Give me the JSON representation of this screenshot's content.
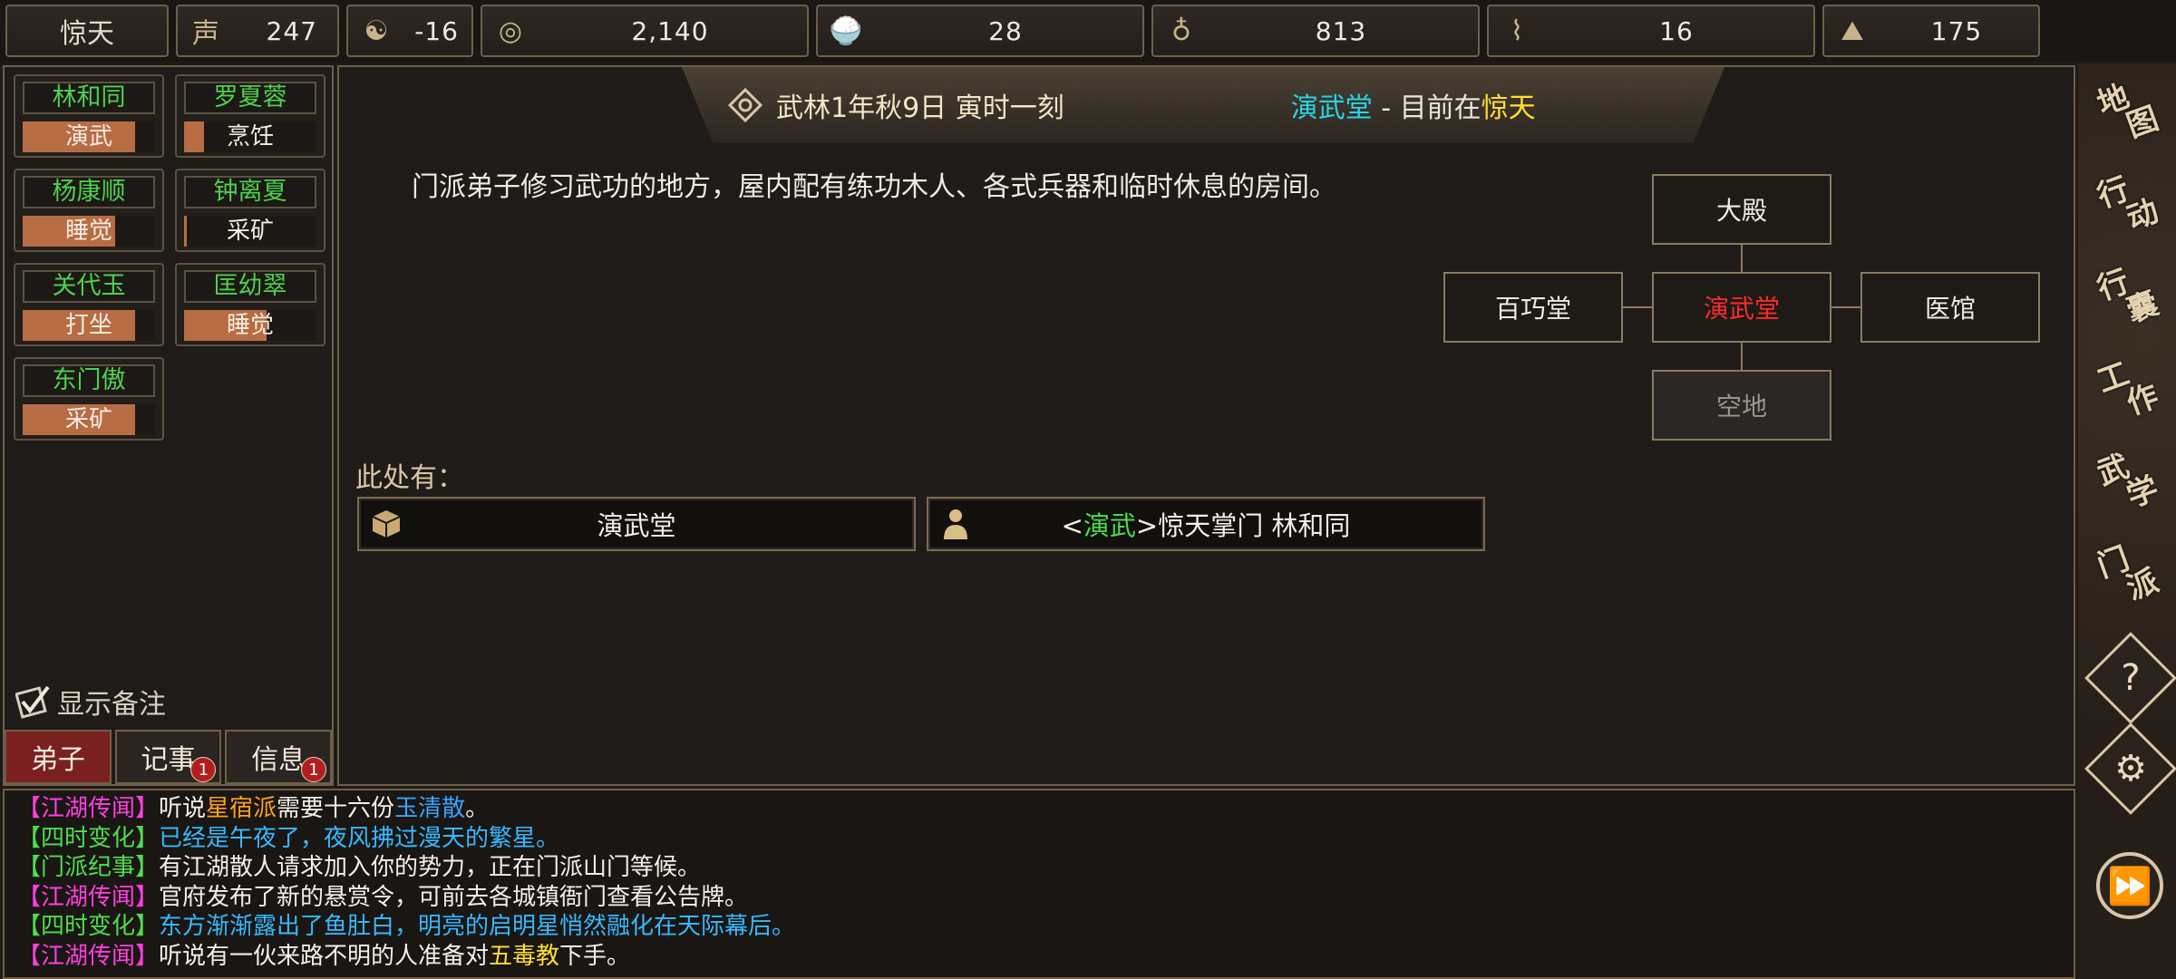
{
  "topbar": {
    "sect_name": "惊天",
    "resources": [
      {
        "icon": "reputation-icon",
        "glyph": "声",
        "value": "247"
      },
      {
        "icon": "yin-yang-icon",
        "glyph": "☯",
        "value": "-16"
      },
      {
        "icon": "coin-icon",
        "glyph": "◎",
        "value": "2,140"
      },
      {
        "icon": "food-bowl-icon",
        "glyph": "🍚",
        "value": "28"
      },
      {
        "icon": "gourd-icon",
        "glyph": "♁",
        "value": "813"
      },
      {
        "icon": "wood-log-icon",
        "glyph": "⌇",
        "value": "16"
      },
      {
        "icon": "ore-icon",
        "glyph": "⛰",
        "value": "175"
      }
    ]
  },
  "disciples": [
    {
      "name": "林和同",
      "activity": "演武",
      "progress": 0.85
    },
    {
      "name": "罗夏蓉",
      "activity": "烹饪",
      "progress": 0.15
    },
    {
      "name": "杨康顺",
      "activity": "睡觉",
      "progress": 0.7
    },
    {
      "name": "钟离夏",
      "activity": "采矿",
      "progress": 0.02
    },
    {
      "name": "关代玉",
      "activity": "打坐",
      "progress": 0.85
    },
    {
      "name": "匡幼翠",
      "activity": "睡觉",
      "progress": 0.62
    },
    {
      "name": "东门傲",
      "activity": "采矿",
      "progress": 0.85
    }
  ],
  "left_panel": {
    "notes_toggle_label": "显示备注",
    "tabs": [
      {
        "label": "弟子",
        "badge": ""
      },
      {
        "label": "记事",
        "badge": "1"
      },
      {
        "label": "信息",
        "badge": "1"
      }
    ]
  },
  "header": {
    "date": "武林1年秋9日 寅时一刻",
    "location_name": "演武堂",
    "location_sep": " - 目前在",
    "location_sect": "惊天"
  },
  "description": "门派弟子修习武功的地方，屋内配有练功木人、各式兵器和临时休息的房间。",
  "map": {
    "north": "大殿",
    "west": "百巧堂",
    "center": "演武堂",
    "east": "医馆",
    "south": "空地"
  },
  "here": {
    "label": "此处有：",
    "items": [
      {
        "icon": "box-icon",
        "text": "演武堂"
      },
      {
        "icon": "person-icon",
        "prefix": "<",
        "role": "演武",
        "suffix": ">惊天掌门  林和同"
      }
    ]
  },
  "right_menu": [
    {
      "label": [
        "地",
        "图"
      ]
    },
    {
      "label": [
        "行",
        "动"
      ]
    },
    {
      "label": [
        "行",
        "囊"
      ]
    },
    {
      "label": [
        "工",
        "作"
      ]
    },
    {
      "label": [
        "武",
        "学"
      ]
    },
    {
      "label": [
        "门",
        "派"
      ]
    }
  ],
  "log": [
    {
      "tag": "【江湖传闻】",
      "parts": [
        "听说",
        "星宿派",
        "需要十六份",
        "玉清散",
        "。"
      ]
    },
    {
      "tag": "【四时变化】",
      "text": "已经是午夜了，夜风拂过漫天的繁星。"
    },
    {
      "tag": "【门派纪事】",
      "text": "有江湖散人请求加入你的势力，正在门派山门等候。"
    },
    {
      "tag": "【江湖传闻】",
      "text": "官府发布了新的悬赏令，可前去各城镇衙门查看公告牌。"
    },
    {
      "tag": "【四时变化】",
      "text": "东方渐渐露出了鱼肚白，明亮的启明星悄然融化在天际幕后。"
    },
    {
      "tag": "【江湖传闻】",
      "parts": [
        "听说有一伙来路不明的人准备对",
        "五毒教",
        "下手。"
      ]
    }
  ]
}
